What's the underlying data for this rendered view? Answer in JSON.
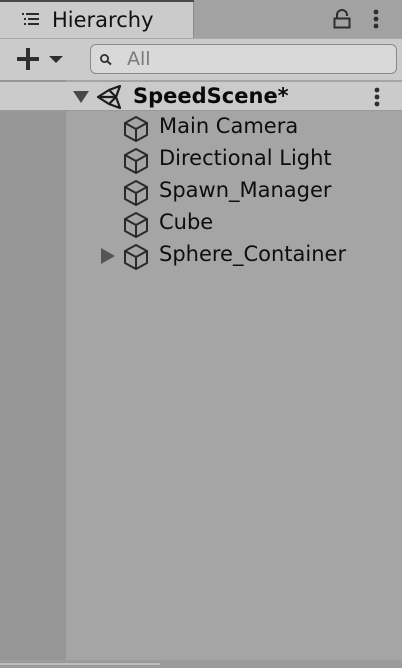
{
  "tab": {
    "title": "Hierarchy",
    "icon": "list-icon"
  },
  "toolbar": {
    "create_icon": "plus-icon",
    "search_placeholder": "All",
    "search_icon": "search-icon"
  },
  "scene": {
    "label": "SpeedScene*",
    "expanded": true
  },
  "objects": [
    {
      "label": "Main Camera",
      "has_children": false
    },
    {
      "label": "Directional Light",
      "has_children": false
    },
    {
      "label": "Spawn_Manager",
      "has_children": false
    },
    {
      "label": "Cube",
      "has_children": false
    },
    {
      "label": "Sphere_Container",
      "has_children": true,
      "expanded": false
    }
  ]
}
